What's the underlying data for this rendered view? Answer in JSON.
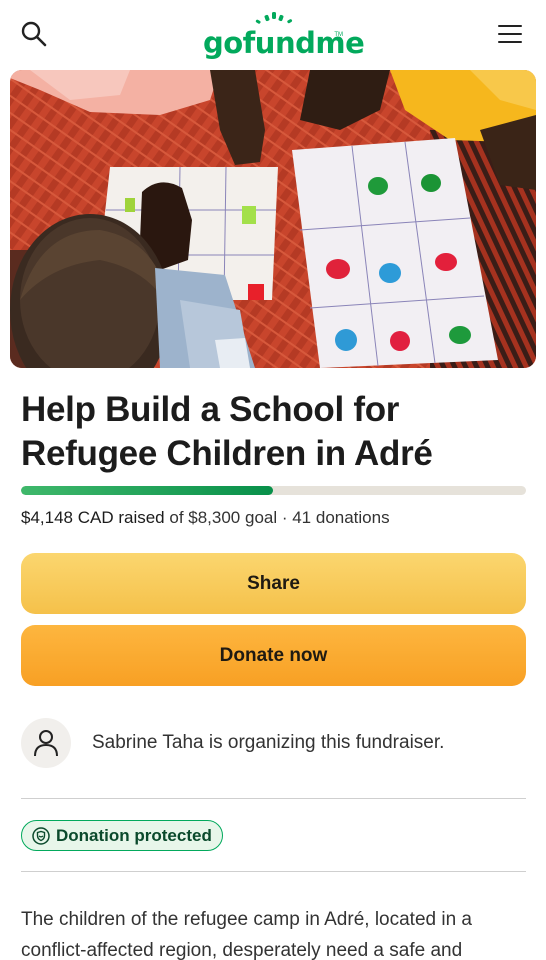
{
  "header": {
    "logo_text": "gofundme",
    "logo_tm": "TM",
    "search_icon": "search-icon",
    "menu_icon": "hamburger-menu-icon"
  },
  "hero": {
    "image": "children-playing-on-paper-grids-photo"
  },
  "campaign": {
    "title": "Help Build a School for Refugee Children in Adré",
    "progress_fraction": 0.4998,
    "raised_text": "$4,148 CAD raised",
    "goal_text": " of $8,300 goal · 41 donations"
  },
  "actions": {
    "share_label": "Share",
    "donate_label": "Donate now"
  },
  "organizer": {
    "avatar_icon": "user-icon",
    "text": "Sabrine Taha is organizing this fundraiser."
  },
  "badge": {
    "icon": "shield-icon",
    "label": "Donation protected"
  },
  "story": {
    "text": "The children of the refugee camp in Adré, located in a conflict-affected region, desperately need a safe and"
  },
  "colors": {
    "brand_green": "#02a95c",
    "share_yellow": "#f5c14a",
    "donate_orange": "#f8a024"
  }
}
